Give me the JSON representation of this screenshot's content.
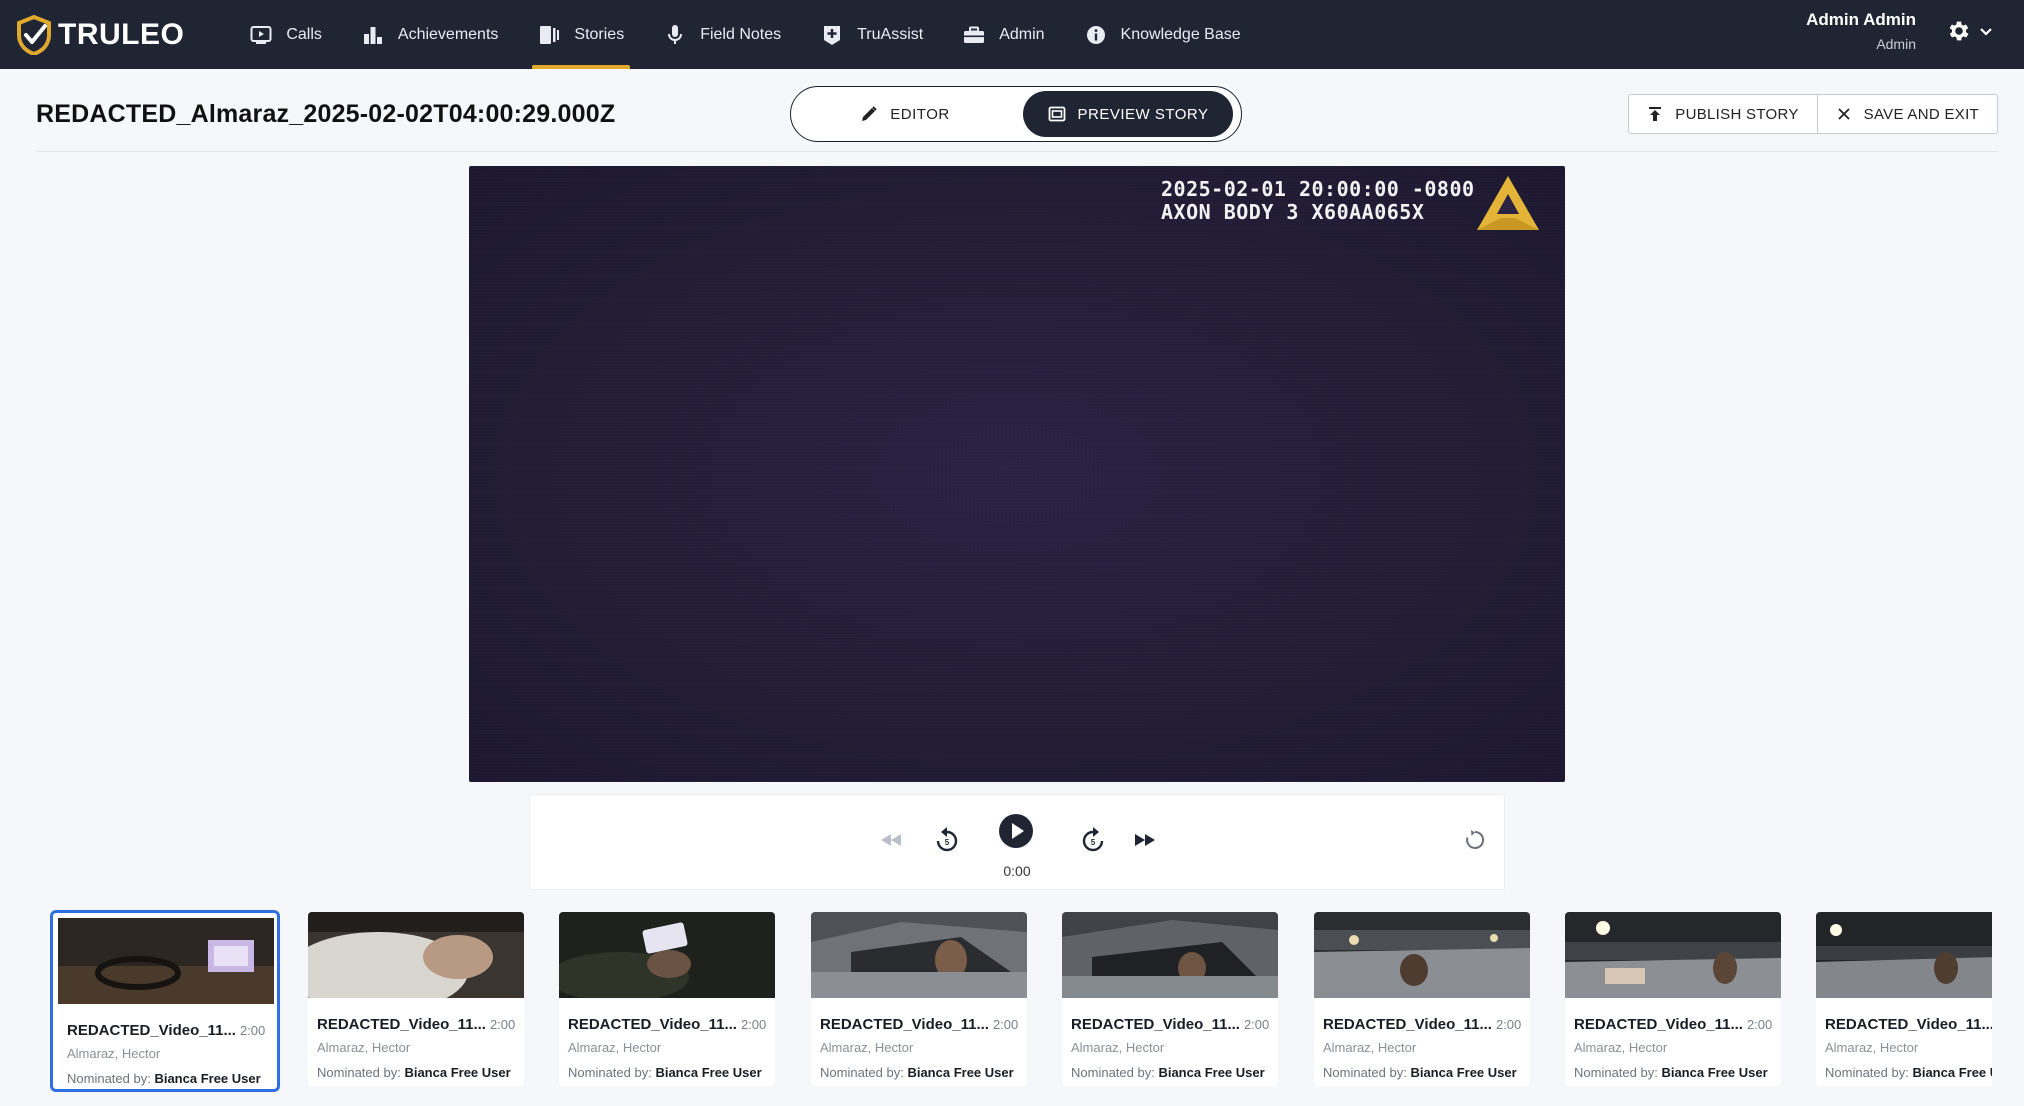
{
  "app": {
    "brand": "TRULEO",
    "accent": "#e0a92e"
  },
  "nav": {
    "items": [
      {
        "label": "Calls",
        "icon": "play-screen-icon"
      },
      {
        "label": "Achievements",
        "icon": "bar-chart-icon"
      },
      {
        "label": "Stories",
        "icon": "stories-icon",
        "active": true
      },
      {
        "label": "Field Notes",
        "icon": "microphone-icon"
      },
      {
        "label": "TruAssist",
        "icon": "plus-badge-icon"
      },
      {
        "label": "Admin",
        "icon": "toolbox-icon"
      },
      {
        "label": "Knowledge Base",
        "icon": "info-icon"
      }
    ]
  },
  "user": {
    "name": "Admin Admin",
    "role": "Admin"
  },
  "story": {
    "title": "REDACTED_Almaraz_2025-02-02T04:00:29.000Z"
  },
  "mode_toggle": {
    "editor_label": "EDITOR",
    "preview_label": "PREVIEW STORY",
    "selected": "preview"
  },
  "actions": {
    "publish_label": "PUBLISH STORY",
    "save_exit_label": "SAVE AND EXIT"
  },
  "video": {
    "overlay_line1": "2025-02-01 20:00:00 -0800",
    "overlay_line2": "AXON BODY 3 X60AA065X"
  },
  "player": {
    "time": "0:00"
  },
  "clips": [
    {
      "title": "REDACTED_Video_11...",
      "duration": "2:00",
      "officer": "Almaraz, Hector",
      "nominated_prefix": "Nominated by:",
      "nominated_by": "Bianca Free User",
      "selected": true
    },
    {
      "title": "REDACTED_Video_11...",
      "duration": "2:00",
      "officer": "Almaraz, Hector",
      "nominated_prefix": "Nominated by:",
      "nominated_by": "Bianca Free User"
    },
    {
      "title": "REDACTED_Video_11...",
      "duration": "2:00",
      "officer": "Almaraz, Hector",
      "nominated_prefix": "Nominated by:",
      "nominated_by": "Bianca Free User"
    },
    {
      "title": "REDACTED_Video_11...",
      "duration": "2:00",
      "officer": "Almaraz, Hector",
      "nominated_prefix": "Nominated by:",
      "nominated_by": "Bianca Free User"
    },
    {
      "title": "REDACTED_Video_11...",
      "duration": "2:00",
      "officer": "Almaraz, Hector",
      "nominated_prefix": "Nominated by:",
      "nominated_by": "Bianca Free User"
    },
    {
      "title": "REDACTED_Video_11...",
      "duration": "2:00",
      "officer": "Almaraz, Hector",
      "nominated_prefix": "Nominated by:",
      "nominated_by": "Bianca Free User"
    },
    {
      "title": "REDACTED_Video_11...",
      "duration": "2:00",
      "officer": "Almaraz, Hector",
      "nominated_prefix": "Nominated by:",
      "nominated_by": "Bianca Free User"
    },
    {
      "title": "REDACTED_Video_11...",
      "duration": "",
      "officer": "Almaraz, Hector",
      "nominated_prefix": "Nominated by:",
      "nominated_by": "Bianca Free User"
    }
  ]
}
